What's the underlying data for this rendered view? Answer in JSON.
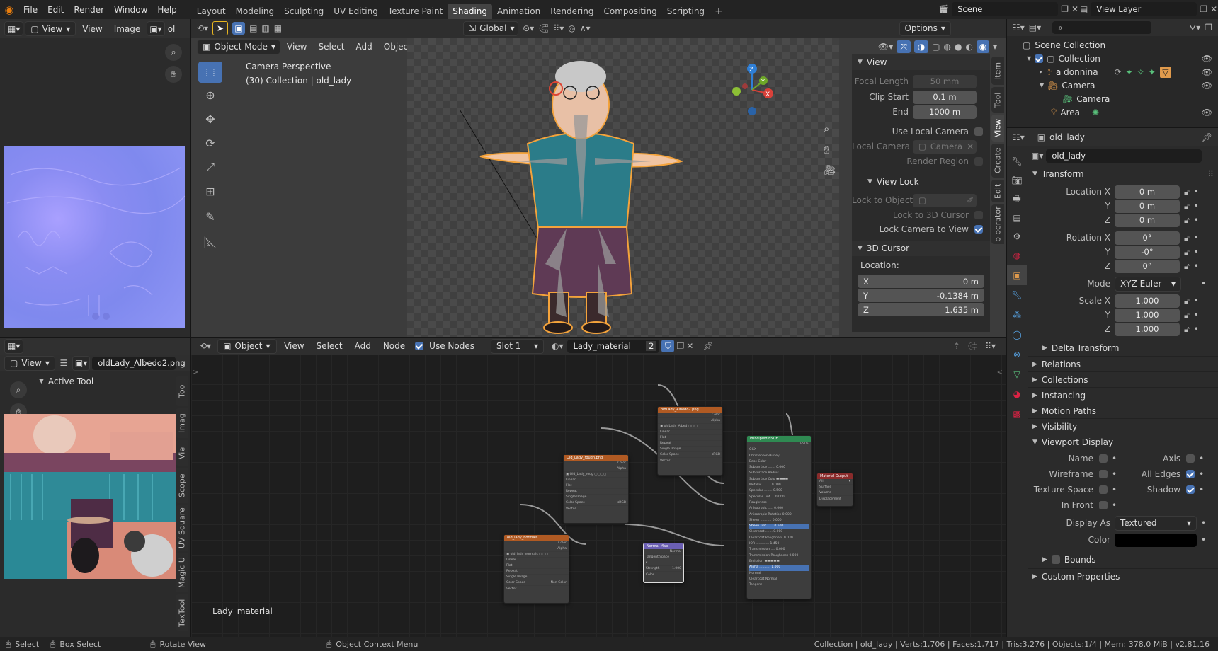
{
  "topbar": {
    "menus": [
      "File",
      "Edit",
      "Render",
      "Window",
      "Help"
    ],
    "workspaces": [
      "Layout",
      "Modeling",
      "Sculpting",
      "UV Editing",
      "Texture Paint",
      "Shading",
      "Animation",
      "Rendering",
      "Compositing",
      "Scripting"
    ],
    "active_workspace": "Shading",
    "scene": "Scene",
    "view_layer": "View Layer"
  },
  "image_editor_top": {
    "menus": [
      "View",
      "View",
      "Image"
    ],
    "truncated": "ol"
  },
  "viewport": {
    "mode": "Object Mode",
    "menus": [
      "View",
      "Select",
      "Add",
      "Object"
    ],
    "transform_orientation": "Global",
    "options": "Options",
    "overlay_title": "Camera Perspective",
    "overlay_sub": "(30) Collection | old_lady"
  },
  "n_panel": {
    "tabs": [
      "Item",
      "Tool",
      "View",
      "Create",
      "Edit",
      "piperator"
    ],
    "active_tab": "View",
    "view_header": "View",
    "focal_length_label": "Focal Length",
    "focal_length": "50 mm",
    "clip_start_label": "Clip Start",
    "clip_start": "0.1 m",
    "end_label": "End",
    "end": "1000 m",
    "use_local_camera": "Use Local Camera",
    "local_camera_label": "Local Camera",
    "local_camera_value": "Camera",
    "render_region": "Render Region",
    "view_lock": "View Lock",
    "lock_to_object": "Lock to Object",
    "lock_to_3d_cursor": "Lock to 3D Cursor",
    "lock_camera_to_view": "Lock Camera to View",
    "cursor_header": "3D Cursor",
    "location_label": "Location:",
    "x_label": "X",
    "x": "0 m",
    "y_label": "Y",
    "y": "-0.1384 m",
    "z_label": "Z",
    "z": "1.635 m"
  },
  "node_editor": {
    "editor": "Object",
    "menus": [
      "View",
      "Select",
      "Add",
      "Node"
    ],
    "use_nodes": "Use Nodes",
    "slot": "Slot 1",
    "material": "Lady_material",
    "users": "2",
    "footer_label": "Lady_material",
    "nodes": {
      "albedo": "oldLady_Albedo2.png",
      "rough": "Old_Lady_rough.png",
      "normal_tex": "old_lady_normals",
      "normal_map": "Normal Map",
      "bsdf": "Principled BSDF",
      "output": "Material Output"
    }
  },
  "uv_editor": {
    "view": "View",
    "image": "oldLady_Albedo2.png",
    "active_tool": "Active Tool",
    "tabs": [
      "Too",
      "Imag",
      "Vie",
      "Scope",
      "UV Square",
      "Magic U",
      "TexTool"
    ]
  },
  "outliner": {
    "scene_collection": "Scene Collection",
    "items": [
      {
        "name": "Collection"
      },
      {
        "name": "a donnina"
      },
      {
        "name": "Camera"
      },
      {
        "name": "Camera"
      },
      {
        "name": "Area"
      }
    ]
  },
  "properties": {
    "object_name": "old_lady",
    "name_field": "old_lady",
    "transform": "Transform",
    "location_x_label": "Location X",
    "loc_x": "0 m",
    "loc_y": "0 m",
    "loc_z": "0 m",
    "rotation_x_label": "Rotation X",
    "rot_x": "0°",
    "rot_y": "-0°",
    "rot_z": "0°",
    "mode_label": "Mode",
    "mode": "XYZ Euler",
    "scale_x_label": "Scale X",
    "scale_x": "1.000",
    "scale_y": "1.000",
    "scale_z": "1.000",
    "y_label": "Y",
    "z_label": "Z",
    "sections": [
      "Delta Transform",
      "Relations",
      "Collections",
      "Instancing",
      "Motion Paths",
      "Visibility"
    ],
    "viewport_display": "Viewport Display",
    "vd": {
      "name": "Name",
      "axis": "Axis",
      "wireframe": "Wireframe",
      "all_edges": "All Edges",
      "texture_space": "Texture Space",
      "shadow": "Shadow",
      "in_front": "In Front",
      "display_as_label": "Display As",
      "display_as": "Textured",
      "color_label": "Color"
    },
    "bounds": "Bounds",
    "custom_properties": "Custom Properties"
  },
  "statusbar": {
    "select": "Select",
    "box_select": "Box Select",
    "rotate_view": "Rotate View",
    "context_menu": "Object Context Menu",
    "stats": "Collection | old_lady | Verts:1,706 | Faces:1,717 | Tris:3,276 | Objects:1/4 | Mem: 378.0 MiB | v2.81.16"
  }
}
